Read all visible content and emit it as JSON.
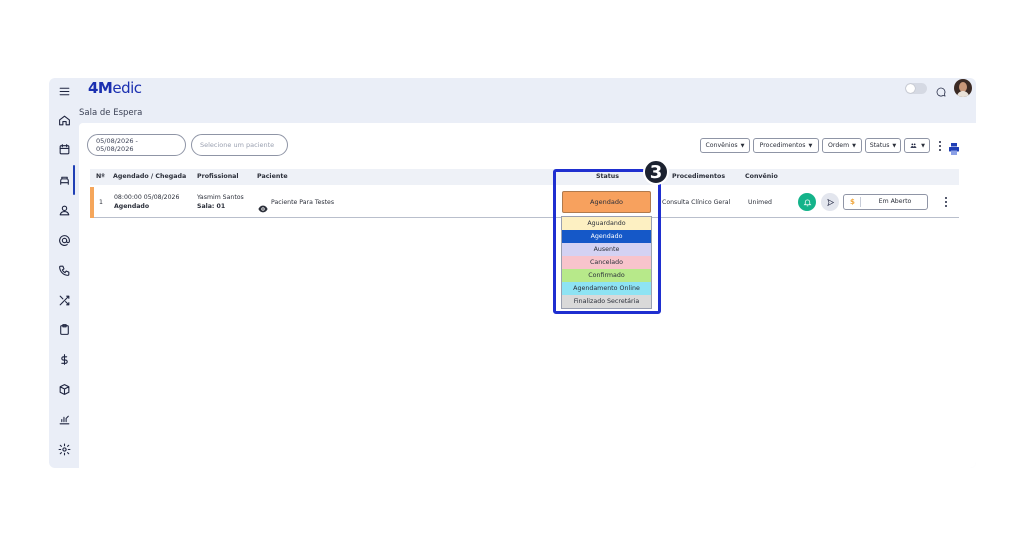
{
  "app": {
    "logo_bold": "4M",
    "logo_rest": "edic",
    "logo_tm": "+",
    "breadcrumb": "Sala de Espera"
  },
  "sidebar": {
    "icons": [
      "menu-icon",
      "home-icon",
      "calendar-icon",
      "waiting-room-icon",
      "patient-icon",
      "email-icon",
      "phone-icon",
      "shuffle-icon",
      "clipboard-icon",
      "dollar-icon",
      "package-icon",
      "chart-icon",
      "settings-icon"
    ]
  },
  "filters": {
    "date_range": "05/08/2026 - 05/08/2026",
    "patient_placeholder": "Selecione um paciente",
    "convenios": "Convênios",
    "procedimentos": "Procedimentos",
    "ordem": "Ordem",
    "status": "Status"
  },
  "table": {
    "headers": {
      "num": "Nº",
      "agendado": "Agendado / Chegada",
      "profissional": "Profissional",
      "paciente": "Paciente",
      "status": "Status",
      "procedimentos": "Procedimentos",
      "convenio": "Convênio"
    },
    "rows": [
      {
        "num": "1",
        "time": "08:00:00 05/08/2026",
        "state": "Agendado",
        "professional": "Yasmim Santos",
        "room": "Sala: 01",
        "patient": "Paciente Para Testes",
        "status": "Agendado",
        "procedure": "Consulta Clínico Geral",
        "insurance": "Unimed",
        "payment": "Em Aberto",
        "payment_symbol": "$"
      }
    ]
  },
  "status_dropdown": {
    "step_number": "3",
    "options": [
      {
        "label": "Aguardando",
        "color": "#fdf0c2"
      },
      {
        "label": "Agendado",
        "color": "#1558c8"
      },
      {
        "label": "Ausente",
        "color": "#d4d2f3"
      },
      {
        "label": "Cancelado",
        "color": "#f8c4cc"
      },
      {
        "label": "Confirmado",
        "color": "#b7e98a"
      },
      {
        "label": "Agendamento Online",
        "color": "#8ee3f3"
      },
      {
        "label": "Finalizado Secretária",
        "color": "#d9d9d9"
      }
    ],
    "selected_index": 1
  },
  "colors": {
    "brand": "#1a2fb0",
    "accent_orange": "#f7a15e",
    "highlight": "#1f2fd0",
    "bell_green": "#14b38a"
  }
}
